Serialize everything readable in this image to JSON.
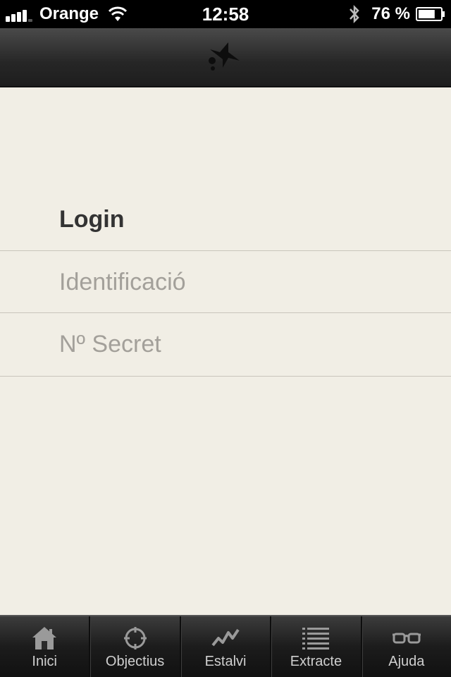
{
  "status_bar": {
    "carrier": "Orange",
    "time": "12:58",
    "battery_percent": "76 %",
    "battery_level": 0.76,
    "signal_bars": 4,
    "signal_bars_total": 5
  },
  "nav_bar": {
    "logo_icon": "star-logo-icon"
  },
  "login": {
    "title": "Login",
    "identification_placeholder": "Identificació",
    "secret_placeholder": "Nº Secret"
  },
  "tab_bar": {
    "tabs": [
      {
        "label": "Inici",
        "icon": "home-icon"
      },
      {
        "label": "Objectius",
        "icon": "target-icon"
      },
      {
        "label": "Estalvi",
        "icon": "trend-icon"
      },
      {
        "label": "Extracte",
        "icon": "list-icon"
      },
      {
        "label": "Ajuda",
        "icon": "glasses-icon"
      }
    ]
  },
  "colors": {
    "content_bg": "#f1eee5",
    "title_text": "#333333",
    "placeholder_text": "#a3a09a",
    "tab_icon": "#9a9a9a"
  }
}
